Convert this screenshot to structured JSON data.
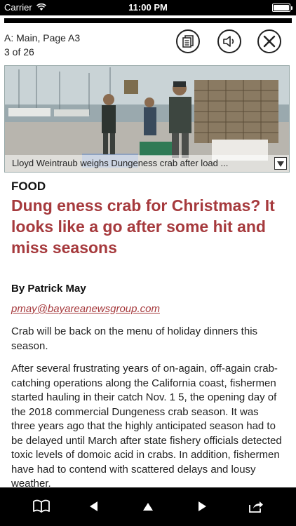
{
  "status_bar": {
    "carrier": "Carrier",
    "time": "11:00 PM",
    "battery_level": 1.0
  },
  "header": {
    "section_page": "A: Main, Page A3",
    "page_count": "3 of 26"
  },
  "toolbar": {
    "icons": [
      "article-icon",
      "speaker-icon",
      "close-icon"
    ]
  },
  "photo": {
    "caption": "Lloyd Weintraub weighs Dungeness crab after load ..."
  },
  "article": {
    "section": "FOOD",
    "headline": "Dung eness crab for Christmas? It looks like a go after some hit and miss seasons",
    "byline": "By Patrick May",
    "email": "pmay@bayareanewsgroup.com",
    "paragraphs": [
      "Crab will be back on the menu of holiday dinners this season.",
      "After several frustrating years of on-again, off-again crab-catching operations along the California coast, fishermen started hauling in their catch Nov. 1 5, the opening day of the 2018 commercial Dungeness crab season. It was three years ago that the highly anticipated season had to be delayed until March after state fishery officials detected toxic levels of domoic acid in crabs. In addition, fishermen have had to contend with scattered delays and lousy weather."
    ]
  },
  "bottom_bar": {
    "icons": [
      "book-icon",
      "previous-icon",
      "up-icon",
      "next-icon",
      "share-icon"
    ]
  },
  "colors": {
    "headline": "#a63a3d",
    "bars": "#000000"
  }
}
